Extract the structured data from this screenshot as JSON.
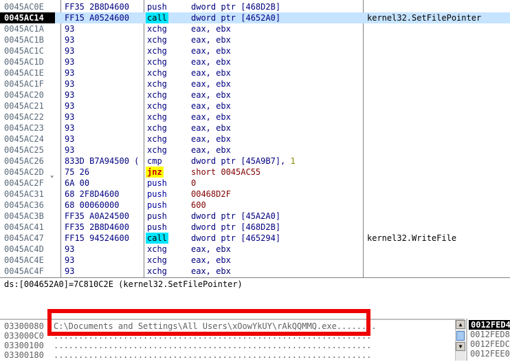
{
  "disasm": {
    "rows": [
      {
        "addr": "0045AC0E",
        "hex": "FF35 2B8D4600",
        "mnemonic": "push",
        "operand": "dword ptr [468D2B]",
        "comment": "",
        "style": "normal"
      },
      {
        "addr": "0045AC14",
        "hex": "FF15 A0524600",
        "mnemonic": "call",
        "operand": "dword ptr [4652A0]",
        "comment": "kernel32.SetFilePointer",
        "style": "current"
      },
      {
        "addr": "0045AC1A",
        "hex": "93",
        "mnemonic": "xchg",
        "operand": "eax, ebx",
        "comment": "",
        "style": "normal"
      },
      {
        "addr": "0045AC1B",
        "hex": "93",
        "mnemonic": "xchg",
        "operand": "eax, ebx",
        "comment": "",
        "style": "normal"
      },
      {
        "addr": "0045AC1C",
        "hex": "93",
        "mnemonic": "xchg",
        "operand": "eax, ebx",
        "comment": "",
        "style": "normal"
      },
      {
        "addr": "0045AC1D",
        "hex": "93",
        "mnemonic": "xchg",
        "operand": "eax, ebx",
        "comment": "",
        "style": "normal"
      },
      {
        "addr": "0045AC1E",
        "hex": "93",
        "mnemonic": "xchg",
        "operand": "eax, ebx",
        "comment": "",
        "style": "normal"
      },
      {
        "addr": "0045AC1F",
        "hex": "93",
        "mnemonic": "xchg",
        "operand": "eax, ebx",
        "comment": "",
        "style": "normal"
      },
      {
        "addr": "0045AC20",
        "hex": "93",
        "mnemonic": "xchg",
        "operand": "eax, ebx",
        "comment": "",
        "style": "normal"
      },
      {
        "addr": "0045AC21",
        "hex": "93",
        "mnemonic": "xchg",
        "operand": "eax, ebx",
        "comment": "",
        "style": "normal"
      },
      {
        "addr": "0045AC22",
        "hex": "93",
        "mnemonic": "xchg",
        "operand": "eax, ebx",
        "comment": "",
        "style": "normal"
      },
      {
        "addr": "0045AC23",
        "hex": "93",
        "mnemonic": "xchg",
        "operand": "eax, ebx",
        "comment": "",
        "style": "normal"
      },
      {
        "addr": "0045AC24",
        "hex": "93",
        "mnemonic": "xchg",
        "operand": "eax, ebx",
        "comment": "",
        "style": "normal"
      },
      {
        "addr": "0045AC25",
        "hex": "93",
        "mnemonic": "xchg",
        "operand": "eax, ebx",
        "comment": "",
        "style": "normal"
      },
      {
        "addr": "0045AC26",
        "hex": "833D B7A94500 (",
        "mnemonic": "cmp",
        "operand": "dword ptr [45A9B7], ",
        "operand_num": "1",
        "comment": "",
        "style": "normal"
      },
      {
        "addr": "0045AC2D",
        "hex": "75 26",
        "mnemonic": "jnz",
        "operand": "short 0045AC55",
        "comment": "",
        "style": "jump"
      },
      {
        "addr": "0045AC2F",
        "hex": "6A 00",
        "mnemonic": "push",
        "operand": "0",
        "comment": "",
        "style": "pushconst"
      },
      {
        "addr": "0045AC31",
        "hex": "68 2F8D4600",
        "mnemonic": "push",
        "operand": "00468D2F",
        "comment": "",
        "style": "pushconst"
      },
      {
        "addr": "0045AC36",
        "hex": "68 00060000",
        "mnemonic": "push",
        "operand": "600",
        "comment": "",
        "style": "pushconst"
      },
      {
        "addr": "0045AC3B",
        "hex": "FF35 A0A24500",
        "mnemonic": "push",
        "operand": "dword ptr [45A2A0]",
        "comment": "",
        "style": "normal"
      },
      {
        "addr": "0045AC41",
        "hex": "FF35 2B8D4600",
        "mnemonic": "push",
        "operand": "dword ptr [468D2B]",
        "comment": "",
        "style": "normal"
      },
      {
        "addr": "0045AC47",
        "hex": "FF15 94524600",
        "mnemonic": "call",
        "operand": "dword ptr [465294]",
        "comment": "kernel32.WriteFile",
        "style": "call"
      },
      {
        "addr": "0045AC4D",
        "hex": "93",
        "mnemonic": "xchg",
        "operand": "eax, ebx",
        "comment": "",
        "style": "normal"
      },
      {
        "addr": "0045AC4E",
        "hex": "93",
        "mnemonic": "xchg",
        "operand": "eax, ebx",
        "comment": "",
        "style": "normal"
      },
      {
        "addr": "0045AC4F",
        "hex": "93",
        "mnemonic": "xchg",
        "operand": "eax, ebx",
        "comment": "",
        "style": "normal"
      }
    ]
  },
  "info": {
    "line": "ds:[004652A0]=7C810C2E (kernel32.SetFilePointer)"
  },
  "dump": {
    "rows": [
      {
        "addr": "03300080",
        "text": "C:\\Documents and Settings\\All Users\\xOowYkUY\\rAkQQMMQ.exe........"
      },
      {
        "addr": "033000C0",
        "text": "................................................................"
      },
      {
        "addr": "03300100",
        "text": "................................................................"
      },
      {
        "addr": "03300180",
        "text": "................................................................"
      }
    ]
  },
  "stack": {
    "rows": [
      "0012FED4",
      "0012FED8",
      "0012FEDC",
      "0012FEE0"
    ]
  },
  "colors": {
    "current_row_bg": "#c6e3ff",
    "call_highlight": "#00e6ff",
    "jump_highlight": "#ffff00",
    "annotation_box": "#ee0000"
  }
}
